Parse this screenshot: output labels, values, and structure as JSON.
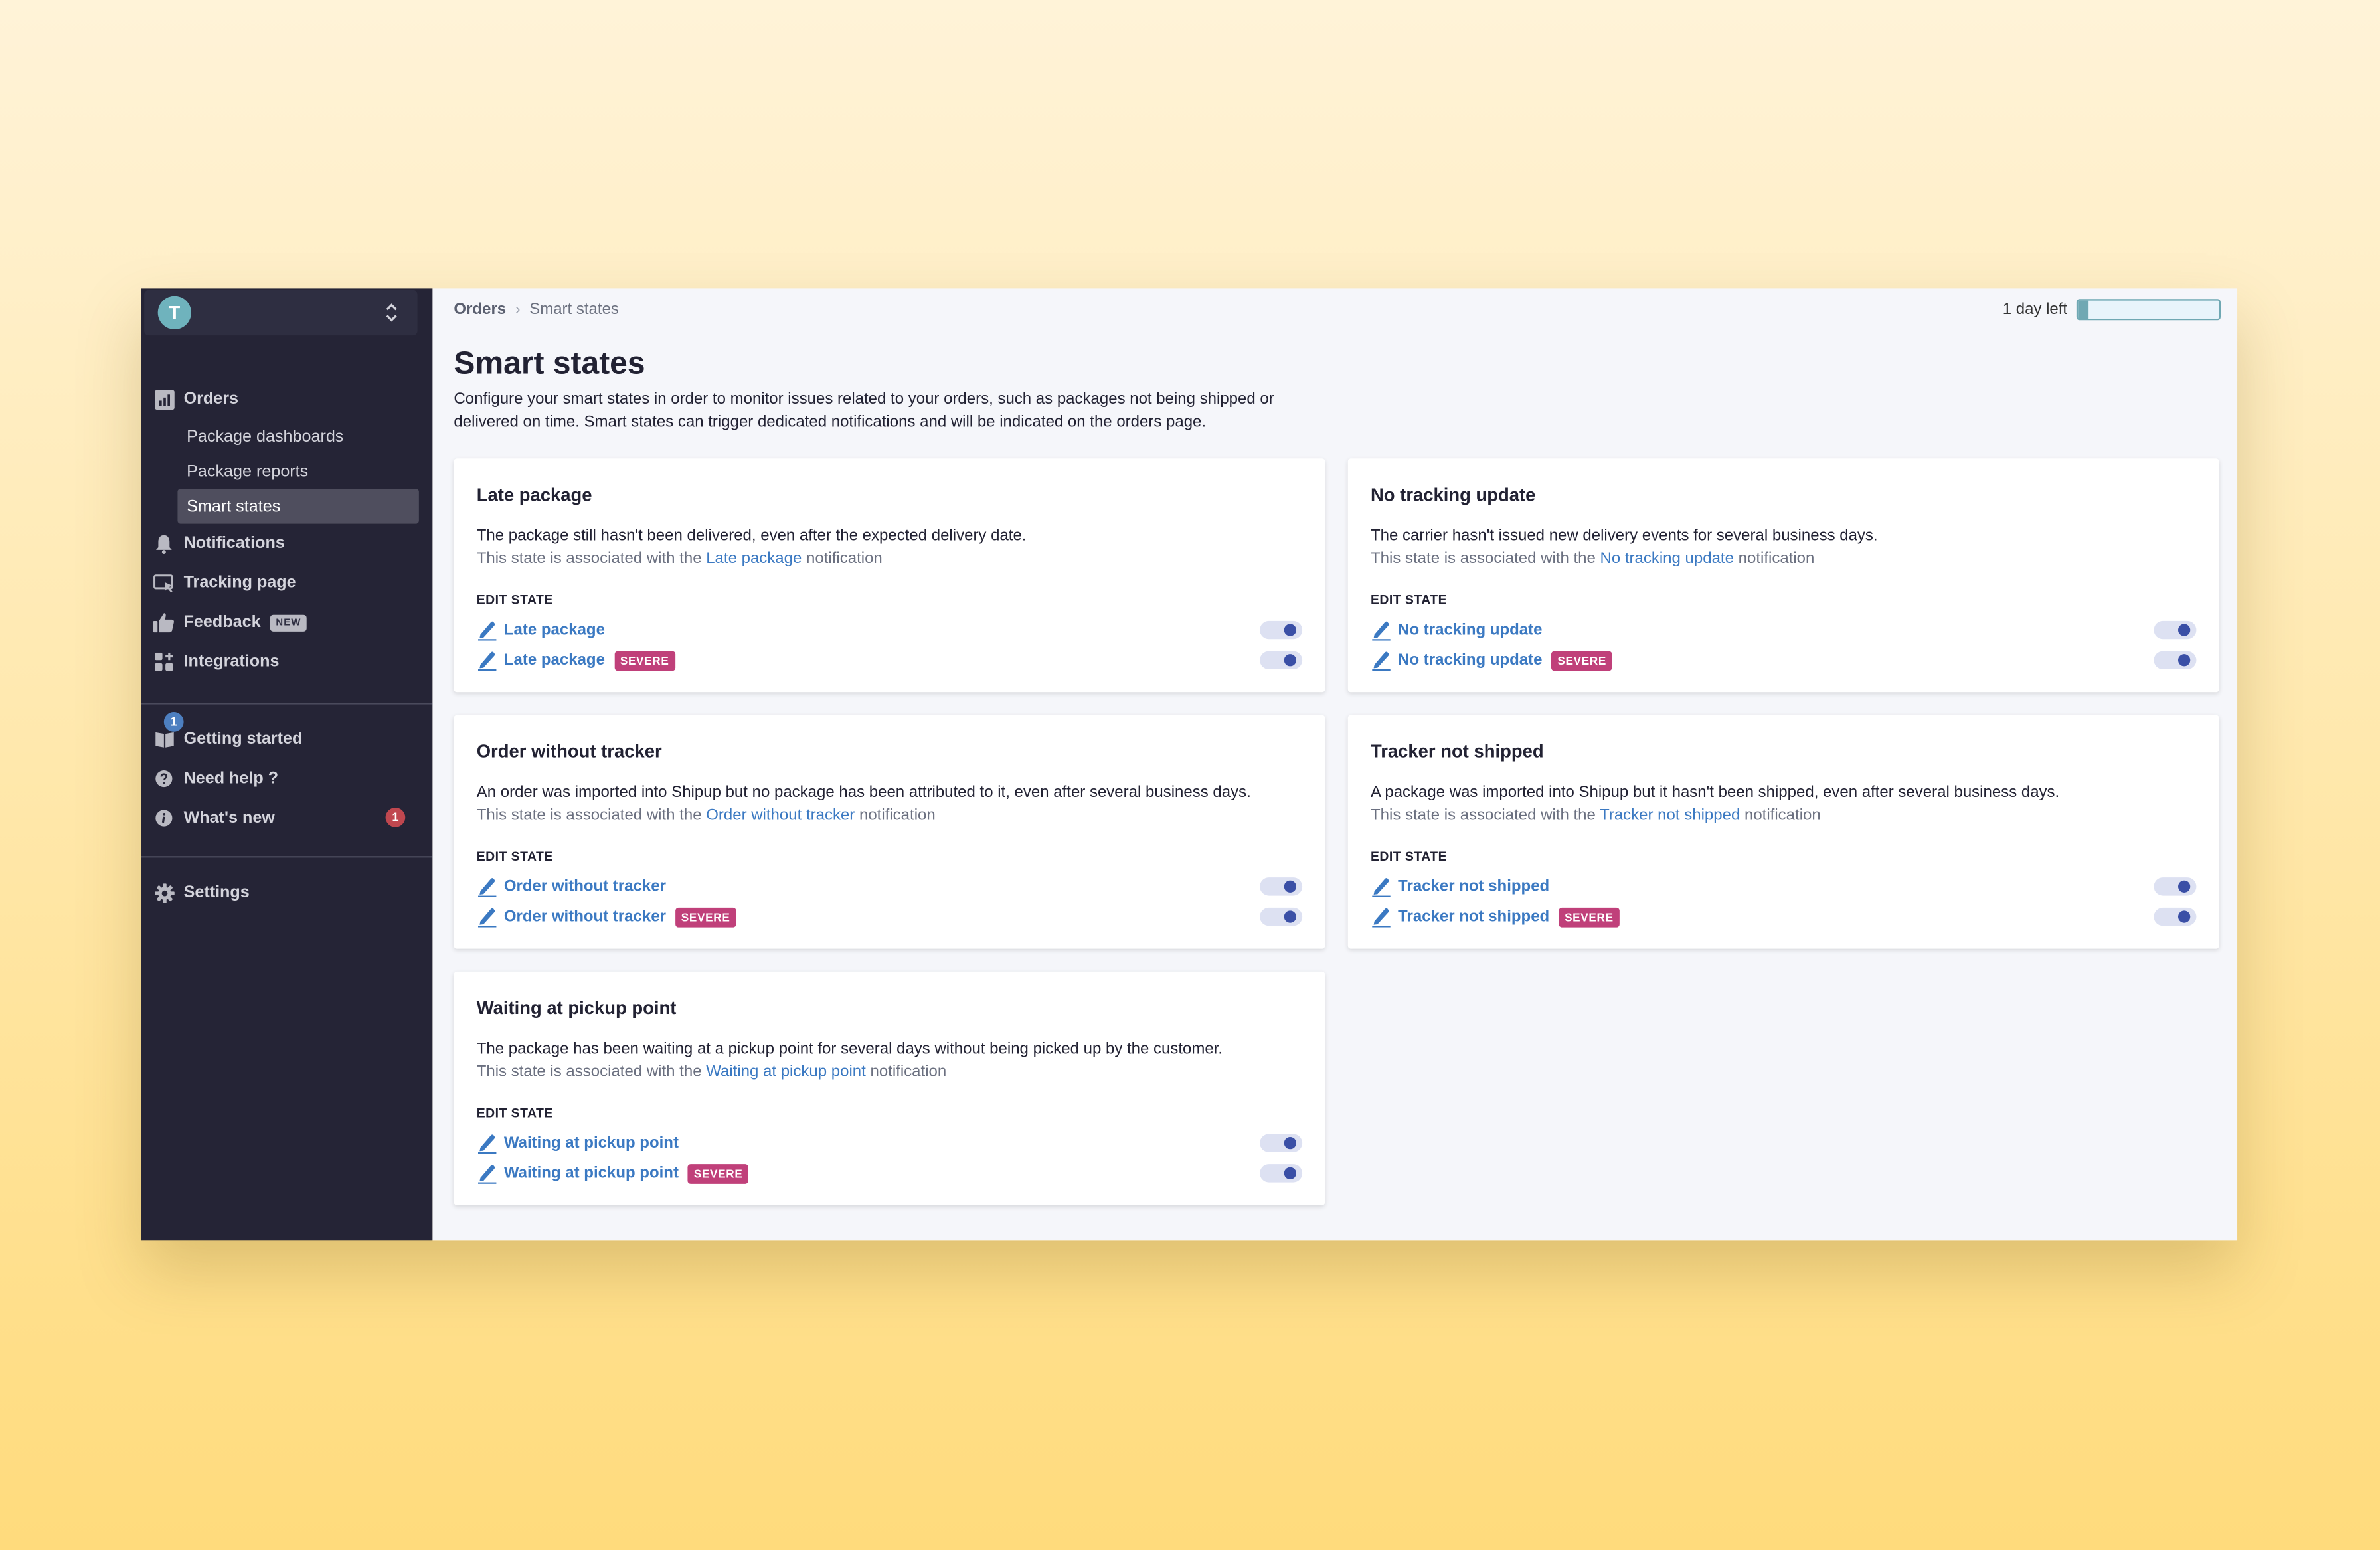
{
  "colors": {
    "sidebar_bg": "#252436",
    "accent_link": "#3b79c2",
    "severe_badge": "#c0407a",
    "toggle_knob": "#3a4fa6",
    "trial_bar": "#6fa8b3",
    "avatar": "#6fb3bd",
    "getting_started_badge": "#4d7fc0",
    "whats_new_badge": "#c0474f"
  },
  "sidebar": {
    "avatar_initial": "T",
    "switcher_icon": "chevron-up-down-icon",
    "nav": [
      {
        "label": "Orders",
        "icon": "bar-chart-icon"
      },
      {
        "label": "Notifications",
        "icon": "bell-icon"
      },
      {
        "label": "Tracking page",
        "icon": "screen-cursor-icon"
      },
      {
        "label": "Feedback",
        "icon": "thumbs-up-icon",
        "badge": "NEW"
      },
      {
        "label": "Integrations",
        "icon": "grid-plus-icon"
      }
    ],
    "sub_items": [
      {
        "label": "Package dashboards",
        "active": false
      },
      {
        "label": "Package reports",
        "active": false
      },
      {
        "label": "Smart states",
        "active": true
      }
    ],
    "help": [
      {
        "label": "Getting started",
        "icon": "book-icon",
        "count": "1"
      },
      {
        "label": "Need help ?",
        "icon": "question-circle-icon"
      },
      {
        "label": "What's new",
        "icon": "info-circle-icon",
        "count": "1"
      }
    ],
    "settings": {
      "label": "Settings",
      "icon": "gear-icon"
    }
  },
  "header": {
    "breadcrumb": [
      "Orders",
      "Smart states"
    ],
    "trial_text": "1 day left",
    "trial_progress_percent": 7
  },
  "page": {
    "title": "Smart states",
    "description": "Configure your smart states in order to monitor issues related to your orders, such as packages not being shipped or delivered on time. Smart states can trigger dedicated notifications and will be indicated on the orders page."
  },
  "common": {
    "assoc_prefix": "This state is associated with the ",
    "assoc_suffix": " notification",
    "edit_state_label": "EDIT STATE",
    "severe_label": "SEVERE"
  },
  "cards": [
    {
      "title": "Late package",
      "description": "The package still hasn't been delivered, even after the expected delivery date.",
      "notification": "Late package",
      "states": [
        {
          "label": "Late package",
          "severe": false,
          "enabled": true
        },
        {
          "label": "Late package",
          "severe": true,
          "enabled": true
        }
      ]
    },
    {
      "title": "No tracking update",
      "description": "The carrier hasn't issued new delivery events for several business days.",
      "notification": "No tracking update",
      "states": [
        {
          "label": "No tracking update",
          "severe": false,
          "enabled": true
        },
        {
          "label": "No tracking update",
          "severe": true,
          "enabled": true
        }
      ]
    },
    {
      "title": "Order without tracker",
      "description": "An order was imported into Shipup but no package has been attributed to it, even after several business days.",
      "notification": "Order without tracker",
      "states": [
        {
          "label": "Order without tracker",
          "severe": false,
          "enabled": true
        },
        {
          "label": "Order without tracker",
          "severe": true,
          "enabled": true
        }
      ]
    },
    {
      "title": "Tracker not shipped",
      "description": "A package was imported into Shipup but it hasn't been shipped, even after several business days.",
      "notification": "Tracker not shipped",
      "states": [
        {
          "label": "Tracker not shipped",
          "severe": false,
          "enabled": true
        },
        {
          "label": "Tracker not shipped",
          "severe": true,
          "enabled": true
        }
      ]
    },
    {
      "title": "Waiting at pickup point",
      "description": "The package has been waiting at a pickup point for several days without being picked up by the customer.",
      "notification": "Waiting at pickup point",
      "states": [
        {
          "label": "Waiting at pickup point",
          "severe": false,
          "enabled": true
        },
        {
          "label": "Waiting at pickup point",
          "severe": true,
          "enabled": true
        }
      ]
    }
  ]
}
